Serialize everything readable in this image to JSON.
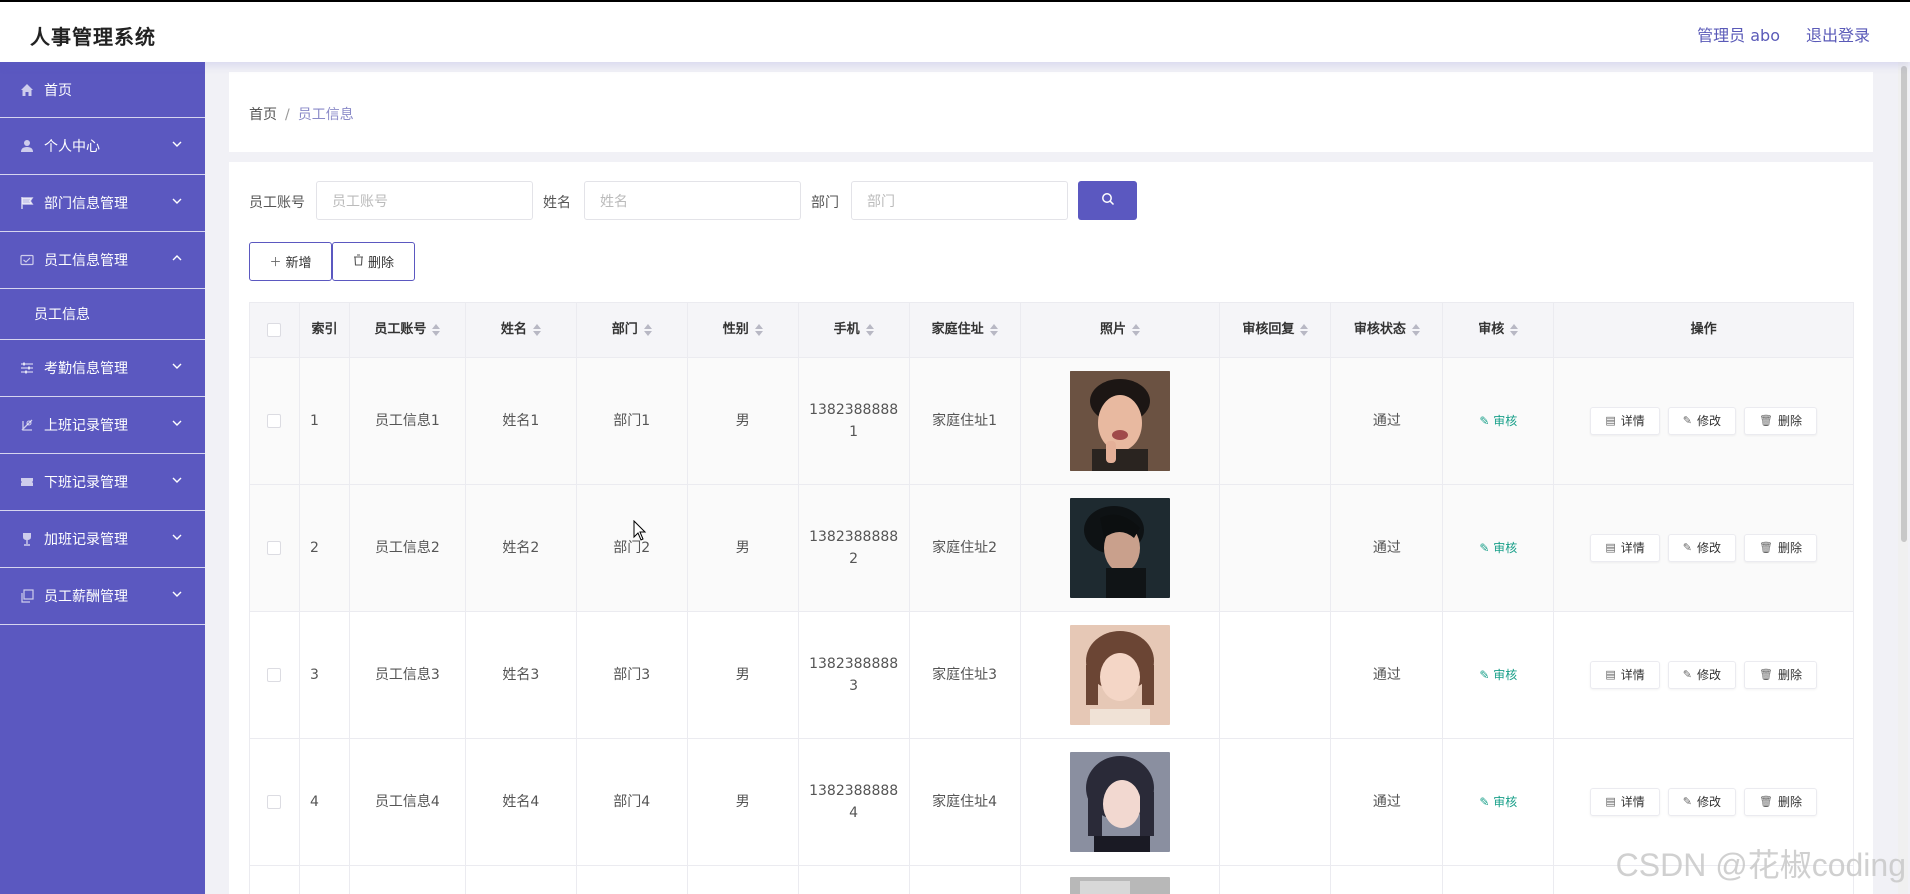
{
  "header": {
    "title": "人事管理系统",
    "admin_label": "管理员 abo",
    "logout_label": "退出登录"
  },
  "sidebar": {
    "items": [
      {
        "label": "首页",
        "icon": "home-icon"
      },
      {
        "label": "个人中心",
        "icon": "user-icon"
      },
      {
        "label": "部门信息管理",
        "icon": "flag-icon"
      },
      {
        "label": "员工信息管理",
        "icon": "id-card-icon",
        "expanded": true,
        "children": [
          {
            "label": "员工信息"
          }
        ]
      },
      {
        "label": "考勤信息管理",
        "icon": "sliders-icon"
      },
      {
        "label": "上班记录管理",
        "icon": "clock-in-icon"
      },
      {
        "label": "下班记录管理",
        "icon": "ticket-icon"
      },
      {
        "label": "加班记录管理",
        "icon": "goblet-icon"
      },
      {
        "label": "员工薪酬管理",
        "icon": "copy-icon"
      }
    ]
  },
  "breadcrumb": {
    "home": "首页",
    "current": "员工信息"
  },
  "search": {
    "account_label": "员工账号",
    "account_placeholder": "员工账号",
    "name_label": "姓名",
    "name_placeholder": "姓名",
    "dept_label": "部门",
    "dept_placeholder": "部门"
  },
  "actions": {
    "add_label": "新增",
    "delete_label": "删除"
  },
  "table": {
    "headers": [
      "索引",
      "员工账号",
      "姓名",
      "部门",
      "性别",
      "手机",
      "家庭住址",
      "照片",
      "审核回复",
      "审核状态",
      "审核",
      "操作"
    ],
    "rows": [
      {
        "index": "1",
        "account": "员工信息1",
        "name": "姓名1",
        "dept": "部门1",
        "gender": "男",
        "phone": "13823888881",
        "phone_l1": "1382388888",
        "phone_l2": "1",
        "address": "家庭住址1",
        "reply": "",
        "status": "通过"
      },
      {
        "index": "2",
        "account": "员工信息2",
        "name": "姓名2",
        "dept": "部门2",
        "gender": "男",
        "phone": "13823888882",
        "phone_l1": "1382388888",
        "phone_l2": "2",
        "address": "家庭住址2",
        "reply": "",
        "status": "通过"
      },
      {
        "index": "3",
        "account": "员工信息3",
        "name": "姓名3",
        "dept": "部门3",
        "gender": "男",
        "phone": "13823888883",
        "phone_l1": "1382388888",
        "phone_l2": "3",
        "address": "家庭住址3",
        "reply": "",
        "status": "通过"
      },
      {
        "index": "4",
        "account": "员工信息4",
        "name": "姓名4",
        "dept": "部门4",
        "gender": "男",
        "phone": "13823888884",
        "phone_l1": "1382388888",
        "phone_l2": "4",
        "address": "家庭住址4",
        "reply": "",
        "status": "通过"
      }
    ],
    "audit_label": "审核",
    "op_detail": "详情",
    "op_edit": "修改",
    "op_delete": "删除"
  },
  "watermark": "CSDN @花椒coding",
  "colors": {
    "primary": "#5b58c0",
    "audit_green": "#1aa08a"
  }
}
